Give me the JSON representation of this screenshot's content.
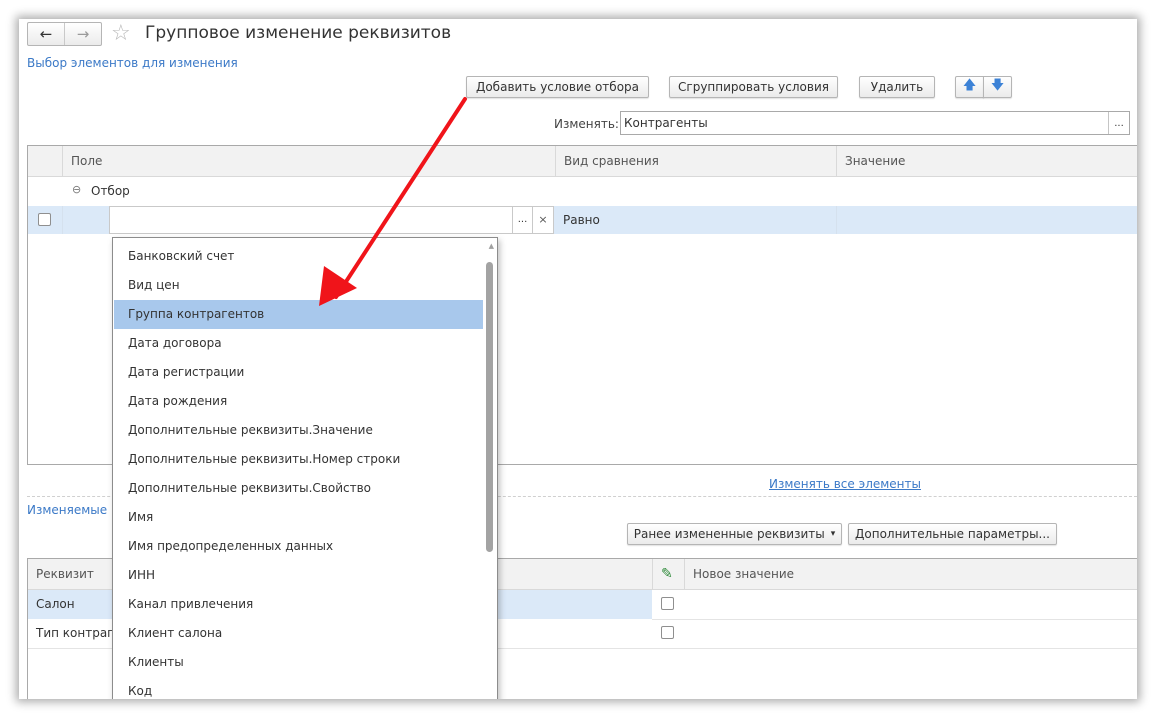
{
  "window": {
    "title": "Групповое изменение реквизитов",
    "back_icon": "←",
    "forward_icon": "→",
    "star_icon": "☆"
  },
  "section1": {
    "link": "Выбор элементов для изменения"
  },
  "toolbar": {
    "add_condition": "Добавить условие отбора",
    "group_conditions": "Сгруппировать условия",
    "delete": "Удалить",
    "up_icon": "🡅",
    "down_icon": "🡇"
  },
  "change_field": {
    "label": "Изменять:",
    "value": "Контрагенты",
    "button": "..."
  },
  "filter_grid": {
    "headers": [
      "Поле",
      "Вид сравнения",
      "Значение"
    ],
    "group_toggle": "⊖",
    "group_label": "Отбор",
    "row": {
      "field_value": "",
      "dots": "...",
      "clear": "×",
      "comparison": "Равно",
      "value": ""
    }
  },
  "change_all_link": "Изменять все элементы",
  "section2": {
    "label": "Изменяемые"
  },
  "toolbar2": {
    "previously_changed": "Ранее измененные реквизиты",
    "dropdown_caret": "▾",
    "additional_params": "Дополнительные параметры..."
  },
  "attr_grid": {
    "headers": [
      "Реквизит",
      "Новое значение"
    ],
    "pencil_icon": "✎",
    "rows": [
      "Салон",
      "Тип контрагента"
    ]
  },
  "dropdown": {
    "scroll_up": "▲",
    "selected_index": 2,
    "items": [
      "Банковский счет",
      "Вид цен",
      "Группа контрагентов",
      "Дата договора",
      "Дата регистрации",
      "Дата рождения",
      "Дополнительные реквизиты.Значение",
      "Дополнительные реквизиты.Номер строки",
      "Дополнительные реквизиты.Свойство",
      "Имя",
      "Имя предопределенных данных",
      "ИНН",
      "Канал привлечения",
      "Клиент салона",
      "Клиенты",
      "Код"
    ]
  },
  "colors": {
    "accent_link": "#3b79c7",
    "selection": "#a8c8ec",
    "row_highlight": "#dbe9f8",
    "arrow": "#f0141a"
  }
}
